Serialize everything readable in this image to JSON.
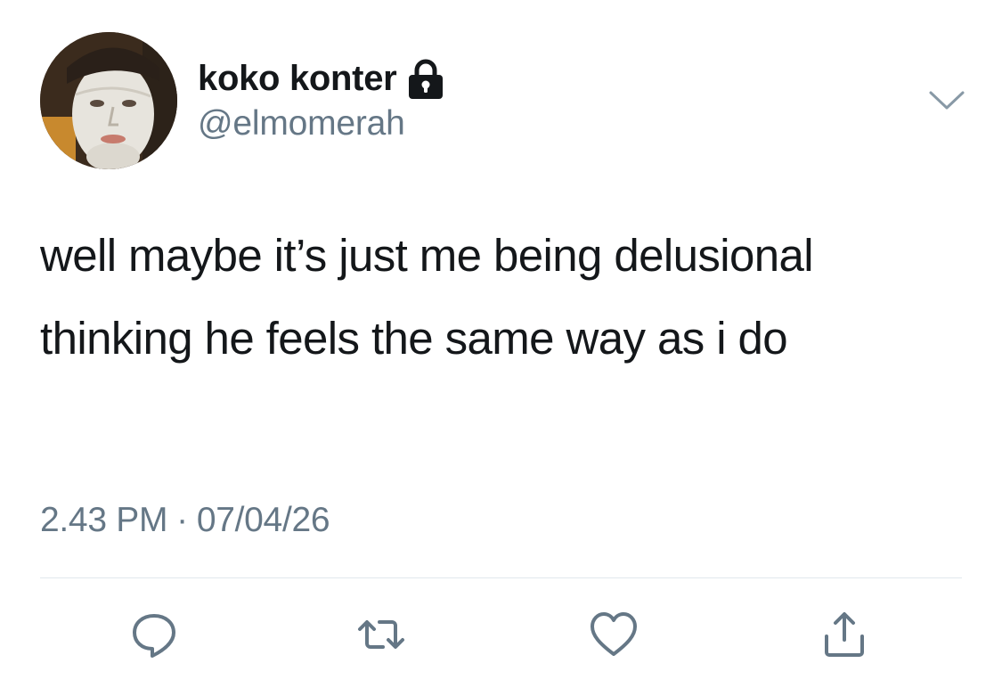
{
  "user": {
    "display_name": "koko konter",
    "handle": "@elmomerah",
    "protected_icon": "lock-icon",
    "avatar": "profile-photo"
  },
  "tweet": {
    "text": "well maybe it’s just me being delusional thinking he feels the same way as i do",
    "time": "2.43 PM",
    "separator": "·",
    "date": "07/04/26"
  },
  "actions": [
    {
      "name": "reply",
      "icon": "reply-icon"
    },
    {
      "name": "retweet",
      "icon": "retweet-icon"
    },
    {
      "name": "like",
      "icon": "heart-icon"
    },
    {
      "name": "share",
      "icon": "share-icon"
    }
  ],
  "menu_icon": "chevron-down-icon",
  "colors": {
    "text": "#14171a",
    "secondary": "#657786",
    "divider": "#e1e8ed",
    "background": "#ffffff"
  }
}
